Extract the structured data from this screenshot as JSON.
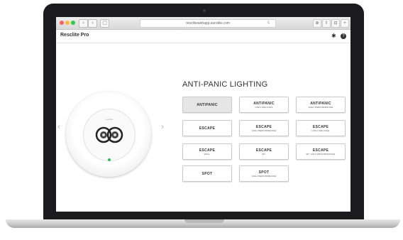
{
  "browser": {
    "url": "resclitewebapp.eurolite.com",
    "back": "‹",
    "forward": "›",
    "sidebar": "▢",
    "reload": "c",
    "right_icons": [
      "⊕",
      "⇧",
      "⊡",
      "+"
    ]
  },
  "app": {
    "title": "Resclite Pro",
    "settings_icon": "✱",
    "help_icon": "?"
  },
  "device": {
    "brand": "eurolite",
    "led_color": "#2fbf55",
    "prev_arrow": "‹",
    "next_arrow": "›"
  },
  "panel": {
    "heading": "ANTI-PANIC LIGHTING",
    "buttons": [
      {
        "label": "ANTIPANIC",
        "sub": "",
        "active": true
      },
      {
        "label": "ANTIPANIC",
        "sub": "HIGH CEILINGS",
        "active": false
      },
      {
        "label": "ANTIPANIC",
        "sub": "HIGH PERFORMANCE",
        "active": false
      },
      {
        "label": "ESCAPE",
        "sub": "",
        "active": false
      },
      {
        "label": "ESCAPE",
        "sub": "HIGH PERFORMANCE",
        "active": false
      },
      {
        "label": "ESCAPE",
        "sub": "HIGH CEILINGS",
        "active": false
      },
      {
        "label": "ESCAPE",
        "sub": "WALL",
        "active": false
      },
      {
        "label": "ESCAPE",
        "sub": "90°",
        "active": false
      },
      {
        "label": "ESCAPE",
        "sub": "90° HIGH PERFORMANCE",
        "active": false
      },
      {
        "label": "SPOT",
        "sub": "",
        "active": false
      },
      {
        "label": "SPOT",
        "sub": "HIGH PERFORMANCE",
        "active": false
      }
    ]
  }
}
